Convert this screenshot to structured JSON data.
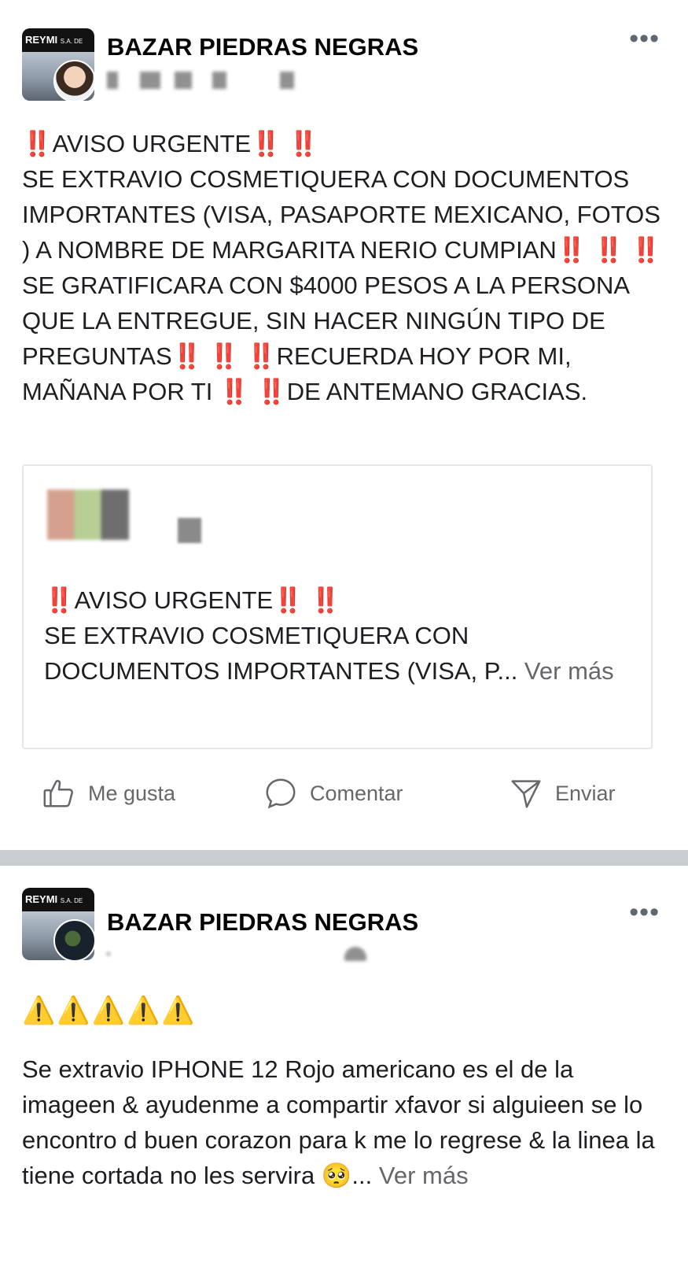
{
  "post1": {
    "avatar_text": "REYMI",
    "avatar_subtext": "S.A. DE C.V.",
    "page_name": "BAZAR PIEDRAS NEGRAS",
    "more": "•••",
    "body": "‼️AVISO URGENTE‼️ ‼️\nSE EXTRAVIO COSMETIQUERA CON DOCUMENTOS IMPORTANTES (VISA, PASAPORTE MEXICANO, FOTOS ) A NOMBRE DE MARGARITA NERIO CUMPIAN‼️ ‼️ ‼️ SE GRATIFICARA CON $4000 PESOS A LA PERSONA QUE LA ENTREGUE, SIN HACER NINGÚN TIPO DE PREGUNTAS‼️ ‼️ ‼️RECUERDA HOY POR MI, MAÑANA POR TI ‼️ ‼️DE ANTEMANO GRACIAS.",
    "shared": {
      "text": "‼️AVISO URGENTE‼️ ‼️\nSE EXTRAVIO COSMETIQUERA CON DOCUMENTOS IMPORTANTES (VISA, P...",
      "see_more": " Ver más"
    },
    "actions": {
      "like": "Me gusta",
      "comment": "Comentar",
      "share": "Enviar"
    }
  },
  "post2": {
    "avatar_text": "REYMI",
    "avatar_subtext": "S.A. DE C.V.",
    "page_name": "BAZAR PIEDRAS NEGRAS",
    "more": "•••",
    "warnings": "⚠️⚠️⚠️⚠️⚠️",
    "body": "Se extravio IPHONE 12 Rojo americano es el de la imageen & ayudenme a compartir xfavor si alguieen se lo encontro d buen corazon para k me lo regrese & la linea la tiene cortada no les servira 🥺...",
    "see_more": " Ver más"
  },
  "colors": {
    "separator": "#c9ccd1",
    "secondary_text": "#65676b",
    "card_border": "#e4e6eb"
  },
  "icons": [
    "thumbs-up-icon",
    "comment-bubble-icon",
    "send-icon",
    "more-options-icon",
    "warning-icon"
  ]
}
